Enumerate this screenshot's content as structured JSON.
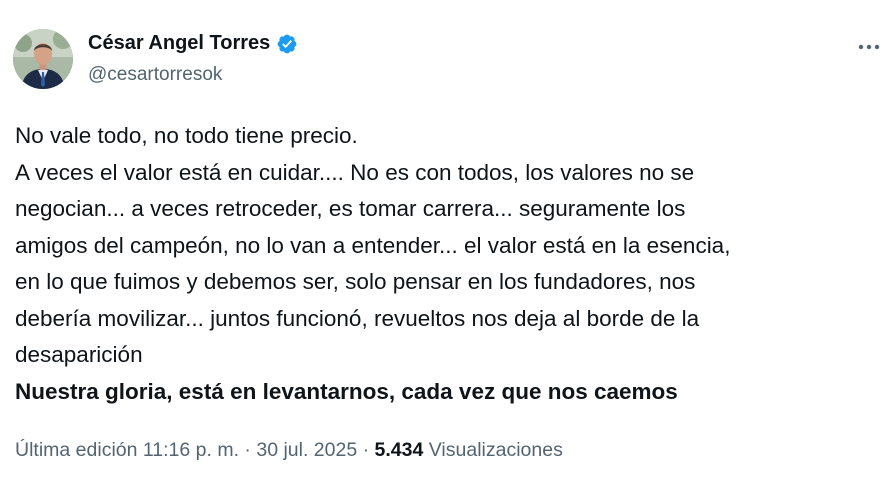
{
  "author": {
    "name": "César Angel Torres",
    "handle": "@cesartorresok",
    "verified_color": "#1d9bf0"
  },
  "more_icon": "ellipsis-icon",
  "tweet": {
    "lines": [
      "No vale todo, no todo tiene precio.",
      "A veces el valor está en cuidar.... No es con todos, los valores no se",
      "negocian... a veces retroceder, es tomar carrera... seguramente los",
      "amigos del campeón, no lo van a entender... el valor está en la esencia,",
      "en lo que fuimos y debemos ser, solo pensar en los fundadores, nos",
      "debería movilizar... juntos funcionó, revueltos nos deja al borde de la",
      "desaparición"
    ],
    "bold_line": "Nuestra gloria, está en levantarnos, cada vez que nos caemos"
  },
  "meta": {
    "edited_label": "Última edición 11:16 p. m.",
    "separator": "·",
    "date": "30 jul. 2025",
    "views_count": "5.434",
    "views_label": "Visualizaciones"
  }
}
